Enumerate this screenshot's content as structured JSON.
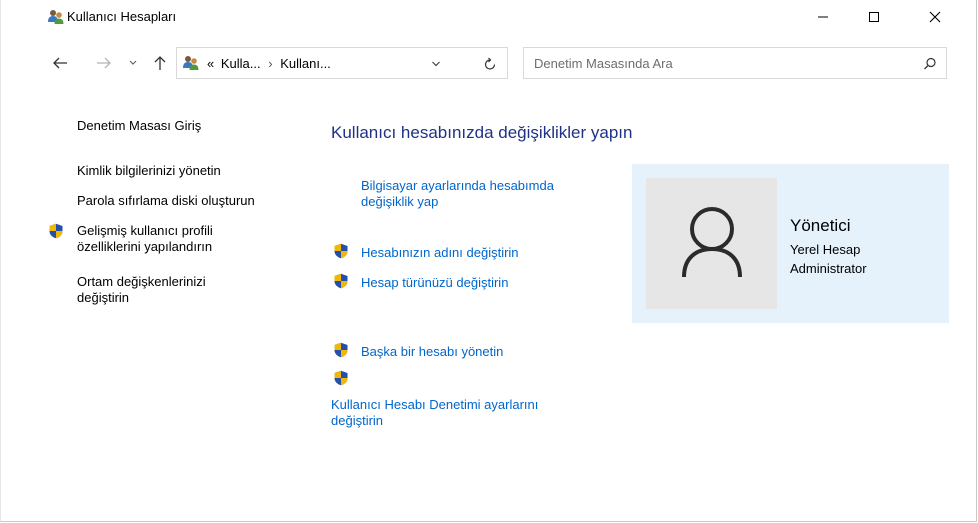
{
  "window": {
    "title": "Kullanıcı Hesapları",
    "controls": {
      "minimize": "minimize",
      "maximize": "maximize",
      "close": "close"
    }
  },
  "address": {
    "overflow": "«",
    "crumb_1": "Kulla...",
    "separator": "›",
    "crumb_2": "Kullanı...",
    "search_placeholder": "Denetim Masasında Ara"
  },
  "sidebar": {
    "home": "Denetim Masası Giriş",
    "items": [
      "Kimlik bilgilerinizi yönetin",
      "Parola sıfırlama diski oluşturun"
    ],
    "advanced_line1": "Gelişmiş kullanıcı profili",
    "advanced_line2": "özelliklerini yapılandırın",
    "env_line1": "Ortam değişkenlerinizi",
    "env_line2": "değiştirin"
  },
  "main": {
    "heading": "Kullanıcı hesabınızda değişiklikler yapın",
    "pc_settings_line1": "Bilgisayar ayarlarında hesabımda",
    "pc_settings_line2": "değişiklik yap",
    "change_name": "Hesabınızın adını değiştirin",
    "change_type": "Hesap türünüzü değiştirin",
    "manage_other": "Başka bir hesabı yönetin",
    "uac_line1": "Kullanıcı Hesabı Denetimi ayarlarını",
    "uac_line2": "değiştirin"
  },
  "account": {
    "name": "Yönetici",
    "type": "Yerel Hesap",
    "role": "Administrator"
  },
  "colors": {
    "link": "#0066cc",
    "heading": "#1e3287",
    "card_bg": "#e5f1fb",
    "shield_blue": "#2450a8",
    "shield_gold": "#f2b705"
  }
}
